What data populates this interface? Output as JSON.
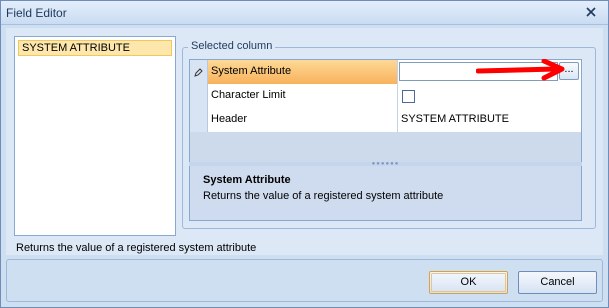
{
  "window": {
    "title": "Field Editor",
    "close_icon": "close-icon"
  },
  "left_list": {
    "items": [
      {
        "label": "SYSTEM ATTRIBUTE",
        "selected": true
      }
    ]
  },
  "property_group": {
    "legend": "Selected column",
    "rows": [
      {
        "label": "System Attribute",
        "value": "",
        "selected": true,
        "editor": "text-with-ellipsis"
      },
      {
        "label": "Character Limit",
        "value": "",
        "editor": "checkbox",
        "checked": false
      },
      {
        "label": "Header",
        "value": "SYSTEM ATTRIBUTE",
        "editor": "text"
      }
    ],
    "ellipsis_label": "...",
    "description": {
      "title": "System Attribute",
      "text": "Returns the value of a registered system attribute"
    }
  },
  "status": {
    "text": "Returns the value of a registered system attribute"
  },
  "buttons": {
    "ok": "OK",
    "cancel": "Cancel"
  },
  "colors": {
    "selection_highlight": "#fde7ac",
    "selected_row": "#f8b25c",
    "annotation_arrow": "#ff0000"
  }
}
